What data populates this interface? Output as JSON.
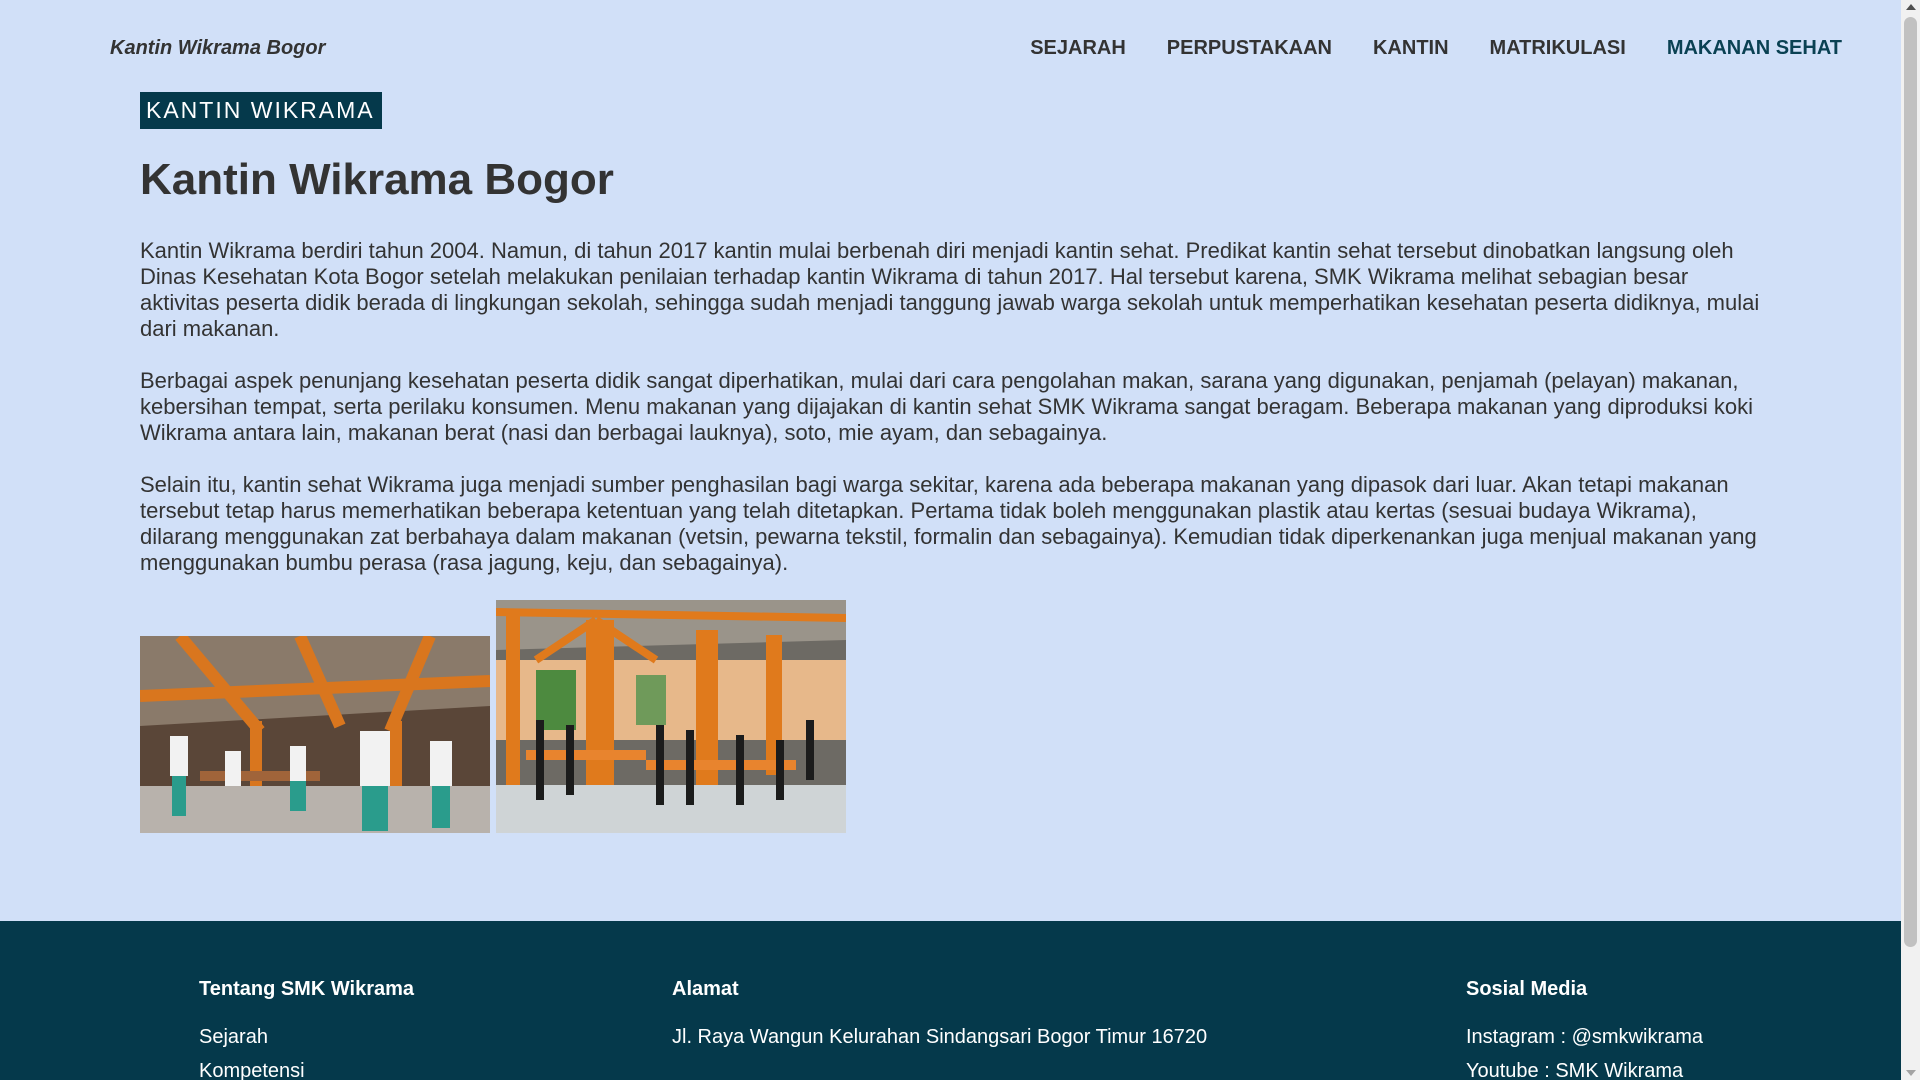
{
  "header": {
    "brand": "Kantin Wikrama Bogor",
    "nav": [
      "SEJARAH",
      "PERPUSTAKAAN",
      "KANTIN",
      "MATRIKULASI",
      "MAKANAN SEHAT"
    ]
  },
  "main": {
    "badge": "KANTIN WIKRAMA",
    "title": "Kantin Wikrama Bogor",
    "paragraphs": [
      "Kantin Wikrama berdiri tahun 2004. Namun, di tahun 2017 kantin mulai berbenah diri menjadi kantin sehat. Predikat kantin sehat tersebut dinobatkan langsung oleh Dinas Kesehatan Kota Bogor setelah melakukan penilaian terhadap kantin Wikrama di tahun 2017. Hal tersebut karena, SMK Wikrama melihat sebagian besar aktivitas peserta didik berada di lingkungan sekolah, sehingga sudah menjadi tanggung jawab warga sekolah untuk memperhatikan kesehatan peserta didiknya, mulai dari makanan.",
      "Berbagai aspek penunjang kesehatan peserta didik sangat diperhatikan, mulai dari cara pengolahan makan, sarana yang digunakan, penjamah (pelayan) makanan, kebersihan tempat, serta perilaku konsumen. Menu makanan yang dijajakan di kantin sehat SMK Wikrama sangat beragam. Beberapa makanan yang diproduksi koki Wikrama antara lain, makanan berat (nasi dan berbagai lauknya), soto, mie ayam, dan sebagainya.",
      "Selain itu, kantin sehat Wikrama juga menjadi sumber penghasilan bagi warga sekitar, karena ada beberapa makanan yang dipasok dari luar. Akan tetapi makanan tersebut tetap harus memerhatikan beberapa ketentuan yang telah ditetapkan. Pertama tidak boleh menggunakan plastik atau kertas (sesuai budaya Wikrama), dilarang menggunakan zat berbahaya dalam makanan (vetsin, pewarna tekstil, formalin dan sebagainya). Kemudian tidak diperkenankan juga menjual makanan yang menggunakan bumbu perasa (rasa jagung, keju, dan sebagainya)."
    ]
  },
  "footer": {
    "about": {
      "heading": "Tentang SMK Wikrama",
      "links": [
        "Sejarah",
        "Kompetensi"
      ]
    },
    "address": {
      "heading": "Alamat",
      "text": "Jl. Raya Wangun Kelurahan Sindangsari Bogor Timur 16720"
    },
    "social": {
      "heading": "Sosial Media",
      "items": [
        "Instagram : @smkwikrama",
        "Youtube : SMK Wikrama"
      ]
    }
  },
  "colors": {
    "page_bg": "#d1e0f8",
    "accent": "#05394b",
    "active_nav": "#0a4153",
    "text": "#333333"
  }
}
